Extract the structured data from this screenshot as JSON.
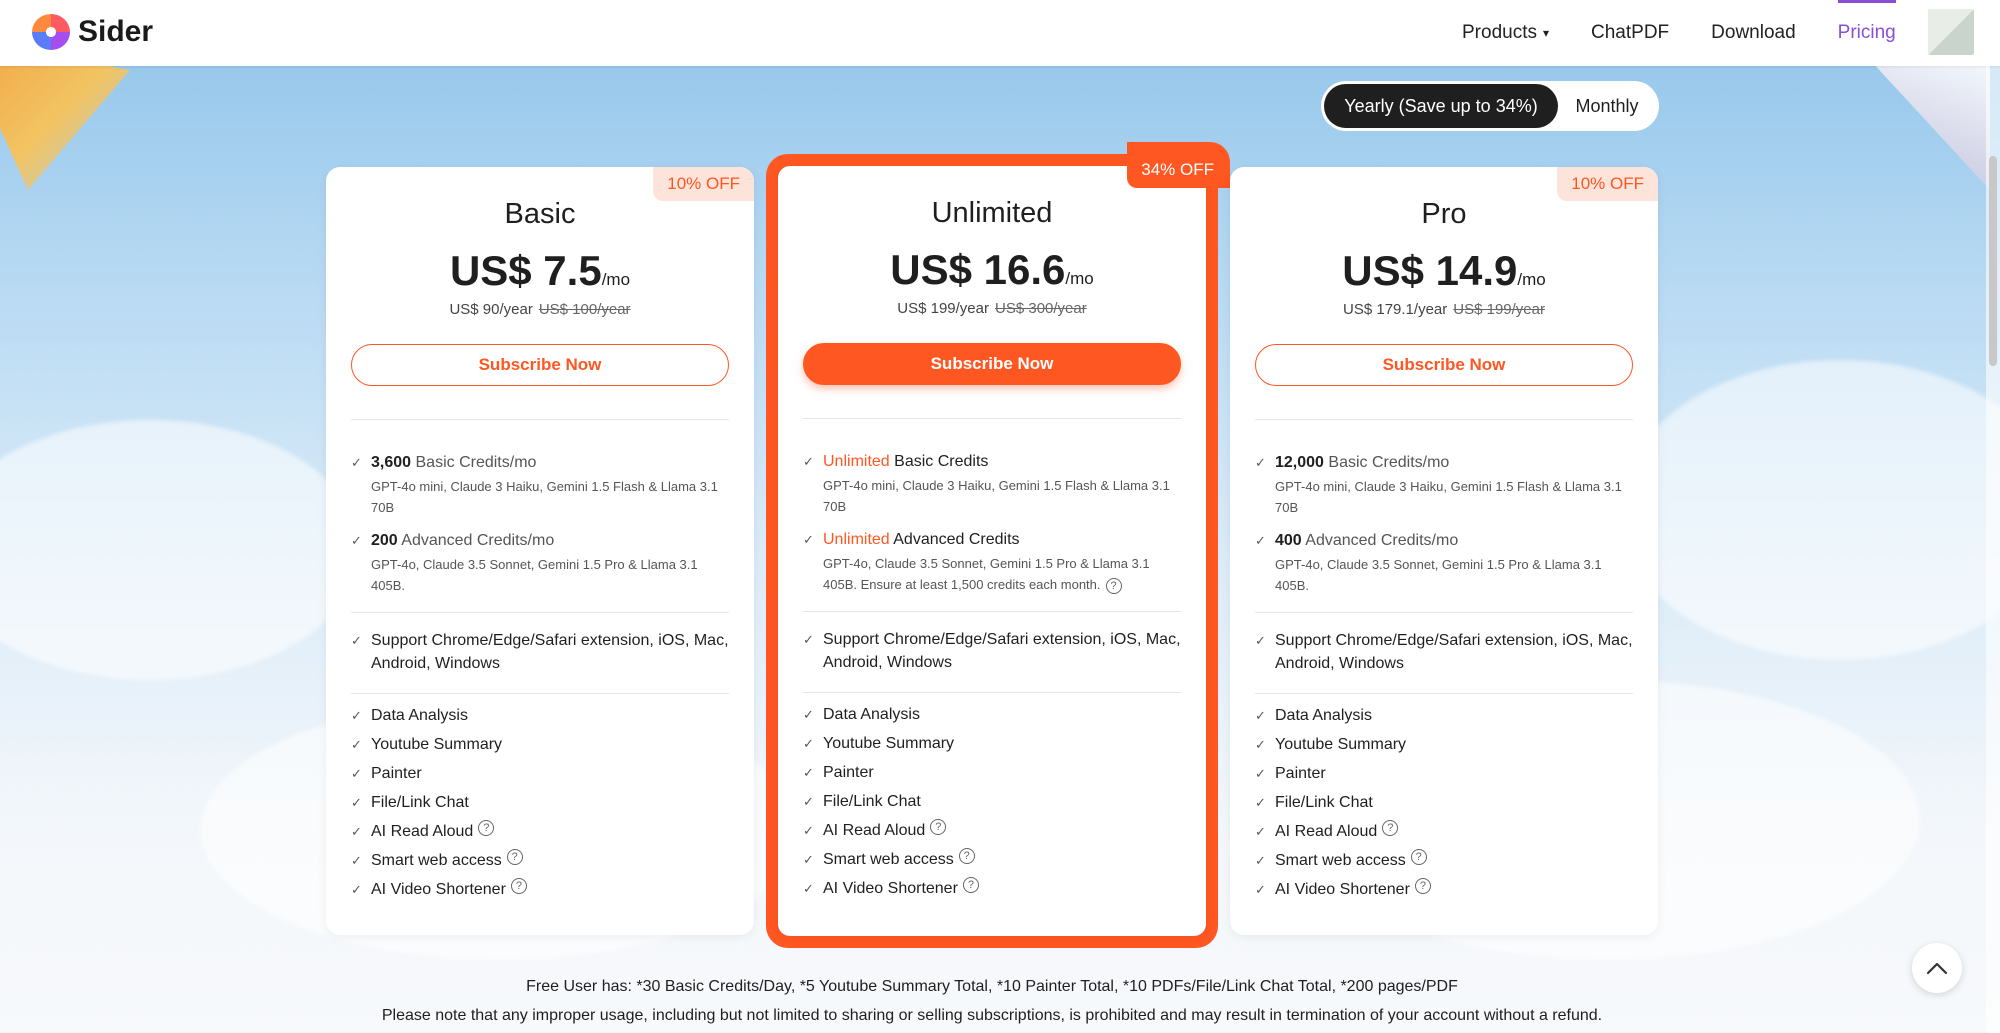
{
  "nav": {
    "brand": "Sider",
    "links": [
      {
        "label": "Products",
        "caret": "▾"
      },
      {
        "label": "ChatPDF"
      },
      {
        "label": "Download"
      },
      {
        "label": "Pricing"
      }
    ]
  },
  "billing_toggle": {
    "yearly": "Yearly (Save up to 34%)",
    "monthly": "Monthly",
    "selected": "yearly"
  },
  "plans": {
    "basic": {
      "badge": "10% OFF",
      "name": "Basic",
      "price": "US$ 7.5",
      "per": "/mo",
      "yearly": "US$ 90/year",
      "yearly_old": "US$ 100/year",
      "cta": "Subscribe Now",
      "basic_credits_value": "3,600",
      "basic_credits_label": "Basic Credits/mo",
      "basic_models": "GPT-4o mini, Claude 3 Haiku, Gemini 1.5 Flash & Llama 3.1 70B",
      "adv_credits_value": "200",
      "adv_credits_label": "Advanced Credits/mo",
      "adv_models": "GPT-4o, Claude 3.5 Sonnet, Gemini 1.5 Pro & Llama 3.1 405B."
    },
    "unlimited": {
      "badge": "34% OFF",
      "name": "Unlimited",
      "price": "US$ 16.6",
      "per": "/mo",
      "yearly": "US$ 199/year",
      "yearly_old": "US$ 300/year",
      "cta": "Subscribe Now",
      "basic_credits_value": "Unlimited",
      "basic_credits_label": "Basic Credits",
      "basic_models": "GPT-4o mini, Claude 3 Haiku, Gemini 1.5 Flash & Llama 3.1 70B",
      "adv_credits_value": "Unlimited",
      "adv_credits_label": "Advanced Credits",
      "adv_models": "GPT-4o, Claude 3.5 Sonnet, Gemini 1.5 Pro & Llama 3.1 405B. Ensure at least 1,500 credits each month."
    },
    "pro": {
      "badge": "10% OFF",
      "name": "Pro",
      "price": "US$ 14.9",
      "per": "/mo",
      "yearly": "US$ 179.1/year",
      "yearly_old": "US$ 199/year",
      "cta": "Subscribe Now",
      "basic_credits_value": "12,000",
      "basic_credits_label": "Basic Credits/mo",
      "basic_models": "GPT-4o mini, Claude 3 Haiku, Gemini 1.5 Flash & Llama 3.1 70B",
      "adv_credits_value": "400",
      "adv_credits_label": "Advanced Credits/mo",
      "adv_models": "GPT-4o, Claude 3.5 Sonnet, Gemini 1.5 Pro & Llama 3.1 405B."
    }
  },
  "common_features": {
    "platforms": "Support Chrome/Edge/Safari extension, iOS, Mac, Android, Windows",
    "data_analysis": "Data Analysis",
    "youtube": "Youtube Summary",
    "painter": "Painter",
    "file_chat": "File/Link Chat",
    "read_aloud": "AI Read Aloud",
    "web_access": "Smart web access",
    "video_shortener": "AI Video Shortener"
  },
  "icons": {
    "check": "check-icon",
    "help": "question-circle-icon",
    "scroll_top": "chevron-up-icon"
  },
  "colors": {
    "accent": "#ff5722",
    "nav_active": "#8a4fd6",
    "toggle_active": "#1f1f1f"
  },
  "footer": {
    "free_user": "Free User has: *30 Basic Credits/Day,  *5 Youtube Summary Total,  *10 Painter Total,  *10 PDFs/File/Link Chat Total,  *200 pages/PDF",
    "notice": "Please note that any improper usage, including but not limited to sharing or selling subscriptions, is prohibited and may result in termination of your account without a refund."
  }
}
